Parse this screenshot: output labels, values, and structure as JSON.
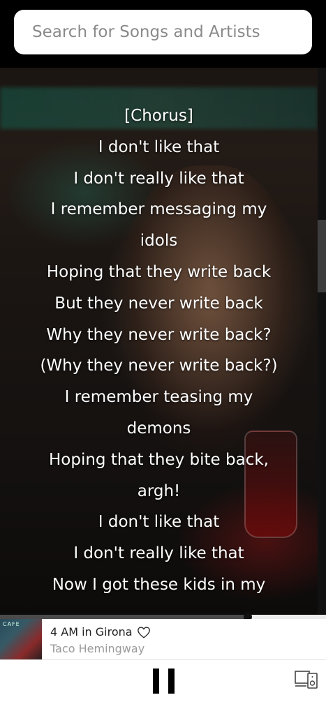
{
  "search": {
    "placeholder": "Search for Songs and Artists"
  },
  "lyrics": {
    "lines": [
      "[Chorus]",
      "I don't like that",
      "I don't really like that",
      "I remember messaging my",
      "idols",
      "Hoping that they write back",
      "But they never write back",
      "Why they never write back?",
      "(Why they never write back?)",
      "I remember teasing my",
      "demons",
      "Hoping that they bite back,",
      "argh!",
      "I don't like that",
      "I don't really like that",
      "Now I got these kids in my"
    ]
  },
  "player": {
    "progress_fraction": 0.76,
    "track_title": "4 AM in Girona",
    "artist": "Taco Hemingway",
    "cover_text": "CAFE",
    "favorite_icon": "heart-outline-icon",
    "play_state_icon": "pause-icon",
    "devices_icon": "devices-icon"
  },
  "colors": {
    "background": "#000000",
    "lyrics_text": "#ffffff",
    "artist_text": "#9a9a9a"
  }
}
